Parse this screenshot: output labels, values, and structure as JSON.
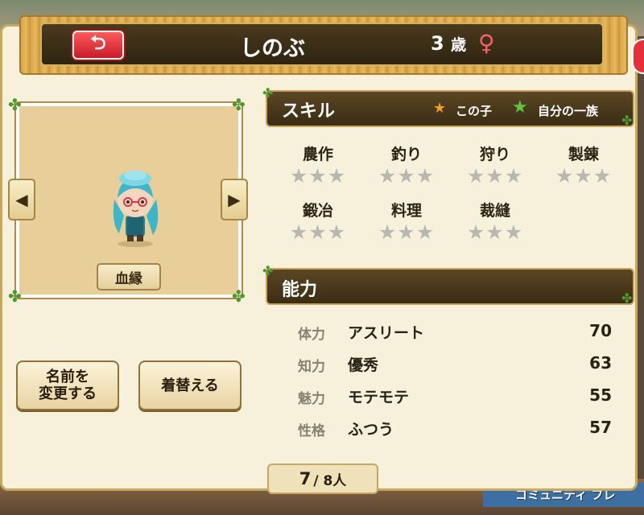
{
  "background": {
    "bottom_sign": "コミュニティ フレ"
  },
  "header": {
    "name": "しのぶ",
    "age_number": "3",
    "age_unit": "歳",
    "gender_symbol": "♀",
    "back_symbol": "⮌"
  },
  "portrait": {
    "kinship_label": "血縁",
    "prev_symbol": "◀",
    "next_symbol": "▶"
  },
  "buttons": {
    "rename_label": "名前を\n変更する",
    "dress_label": "着替える"
  },
  "skills": {
    "title": "スキル",
    "legend_child": "この子",
    "legend_clan": "自分の一族",
    "items": [
      {
        "name": "農作",
        "stars": "★★★",
        "filled": 0
      },
      {
        "name": "釣り",
        "stars": "★★★",
        "filled": 0
      },
      {
        "name": "狩り",
        "stars": "★★★",
        "filled": 0
      },
      {
        "name": "製錬",
        "stars": "★★★",
        "filled": 0
      },
      {
        "name": "鍛冶",
        "stars": "★★★",
        "filled": 0
      },
      {
        "name": "料理",
        "stars": "★★★",
        "filled": 0
      },
      {
        "name": "裁縫",
        "stars": "★★★",
        "filled": 0
      }
    ]
  },
  "abilities": {
    "title": "能力",
    "rows": [
      {
        "label": "体力",
        "value": "アスリート",
        "number": "70"
      },
      {
        "label": "知力",
        "value": "優秀",
        "number": "63"
      },
      {
        "label": "魅力",
        "value": "モテモテ",
        "number": "55"
      },
      {
        "label": "性格",
        "value": "ふつう",
        "number": "57"
      }
    ]
  },
  "pager": {
    "current": "7",
    "total": "/ 8人"
  },
  "colors": {
    "star_gold": "#f0a020",
    "star_green": "#5fc53a",
    "gender": "#ff5c6c",
    "star_empty": "#b9b7b2"
  }
}
